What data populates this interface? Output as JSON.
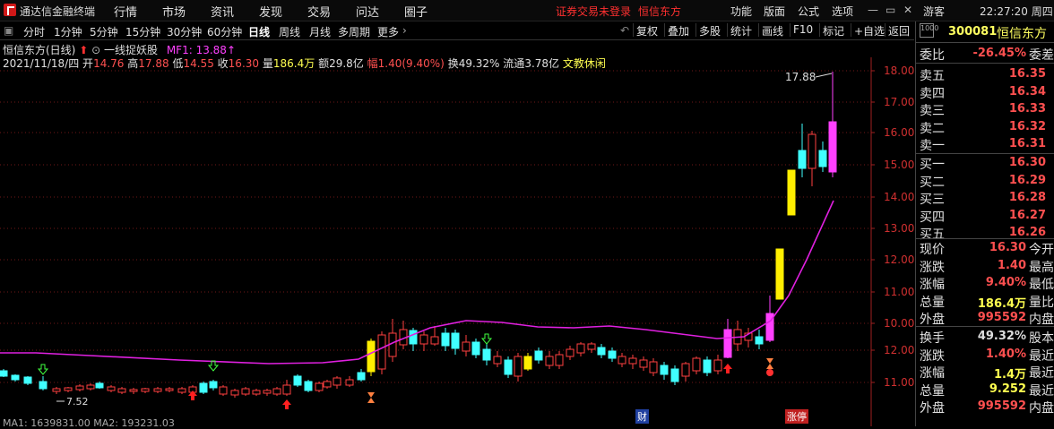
{
  "app": {
    "title": "通达信金融终端"
  },
  "menu": [
    "行情",
    "市场",
    "资讯",
    "发现",
    "交易",
    "问达",
    "圈子"
  ],
  "alert": {
    "login": "证券交易未登录",
    "stock": "恒信东方"
  },
  "topright": [
    "功能",
    "版面",
    "公式",
    "选项"
  ],
  "user": "游客",
  "clock": "22:27:20 周四",
  "periods": [
    "分时",
    "1分钟",
    "5分钟",
    "15分钟",
    "30分钟",
    "60分钟",
    "日线",
    "周线",
    "月线",
    "多周期",
    "更多"
  ],
  "active_period": "日线",
  "tools": [
    "复权",
    "叠加",
    "多股",
    "统计",
    "画线",
    "F10",
    "标记",
    "+自选",
    "返回"
  ],
  "stock_line": {
    "name": "恒信东方(日线)",
    "indicator": "一线捉妖股",
    "mf": "MF1: 13.88"
  },
  "quote_line": {
    "date": "2021/11/18/四",
    "open_label": "开",
    "open": "14.76",
    "high_label": "高",
    "high": "17.88",
    "low_label": "低",
    "low": "14.55",
    "close_label": "收",
    "close": "16.30",
    "vol_label": "量",
    "vol": "186.4万",
    "amt_label": "额",
    "amt": "29.8亿",
    "chg_label": "幅",
    "chg": "1.40(9.40%)",
    "turn_label": "换",
    "turn": "49.32%",
    "float_label": "流通",
    "float": "3.78亿",
    "sector": "文教休闲"
  },
  "bottom_line": "MA1: 1639831.00  MA2: 193231.03",
  "bottom_mark": "财",
  "chart_data": {
    "type": "candlestick",
    "y_ticks": [
      "18.00",
      "17.00",
      "16.00",
      "15.00",
      "14.00",
      "13.00",
      "12.00",
      "11.00",
      "10.00",
      "12.00",
      "11.00"
    ],
    "high_label": "17.88",
    "low_label": "7.52",
    "zhangting_label": "涨停",
    "ylim": [
      10.6,
      18.5
    ]
  },
  "panel": {
    "code": "300081",
    "name": "恒信东方",
    "weibi": {
      "label": "委比",
      "value": "-26.45%",
      "x": "委差"
    },
    "asks": [
      {
        "label": "卖五",
        "price": "16.35"
      },
      {
        "label": "卖四",
        "price": "16.34"
      },
      {
        "label": "卖三",
        "price": "16.33"
      },
      {
        "label": "卖二",
        "price": "16.32"
      },
      {
        "label": "卖一",
        "price": "16.31"
      }
    ],
    "bids": [
      {
        "label": "买一",
        "price": "16.30"
      },
      {
        "label": "买二",
        "price": "16.29"
      },
      {
        "label": "买三",
        "price": "16.28"
      },
      {
        "label": "买四",
        "price": "16.27"
      },
      {
        "label": "买五",
        "price": "16.26"
      }
    ],
    "stats": [
      {
        "label": "现价",
        "value": "16.30",
        "x": "今开"
      },
      {
        "label": "涨跌",
        "value": "1.40",
        "x": "最高"
      },
      {
        "label": "涨幅",
        "value": "9.40%",
        "x": "最低"
      },
      {
        "label": "总量",
        "value": "186.4万",
        "x": "量比"
      },
      {
        "label": "外盘",
        "value": "995592",
        "x": "内盘"
      }
    ],
    "stats2": [
      {
        "label": "换手",
        "value": "49.32%",
        "x": "股本"
      },
      {
        "label": "涨跌",
        "value": "1.40%",
        "x": "最近"
      },
      {
        "label": "涨幅",
        "value": "1.4万",
        "x": "最近"
      },
      {
        "label": "总量",
        "value": "9.252",
        "x": "最近"
      },
      {
        "label": "外盘",
        "value": "995592",
        "x": "内盘"
      }
    ]
  }
}
